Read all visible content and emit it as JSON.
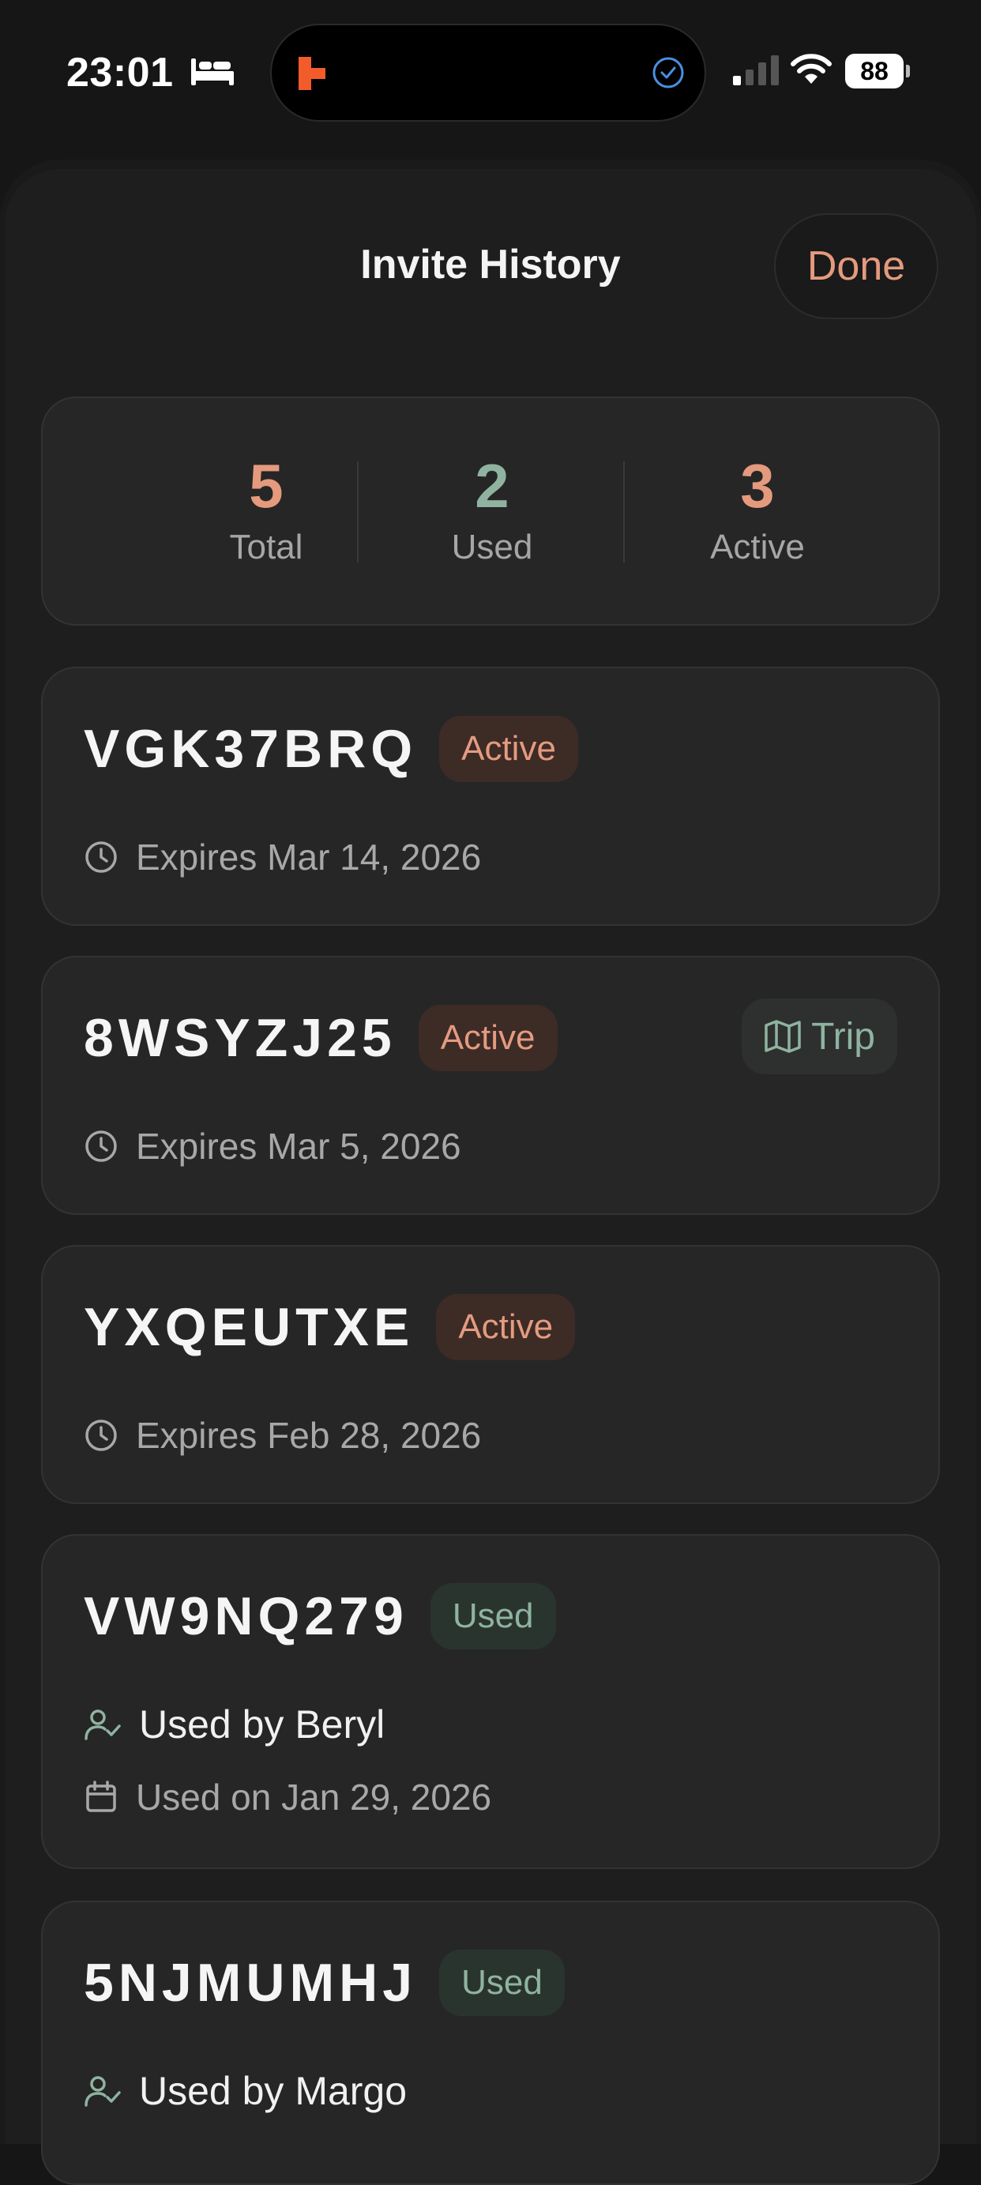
{
  "status_bar": {
    "time": "23:01",
    "battery": "88"
  },
  "header": {
    "title": "Invite History",
    "done_label": "Done"
  },
  "stats": [
    {
      "value": "5",
      "label": "Total",
      "color": "#e59a7e"
    },
    {
      "value": "2",
      "label": "Used",
      "color": "#8fb3a0"
    },
    {
      "value": "3",
      "label": "Active",
      "color": "#e59a7e"
    }
  ],
  "invites": [
    {
      "code": "VGK37BRQ",
      "status": "Active",
      "expires": "Expires Mar 14, 2026"
    },
    {
      "code": "8WSYZJ25",
      "status": "Active",
      "trip_label": "Trip",
      "expires": "Expires Mar 5, 2026"
    },
    {
      "code": "YXQEUTXE",
      "status": "Active",
      "expires": "Expires Feb 28, 2026"
    },
    {
      "code": "VW9NQ279",
      "status": "Used",
      "used_by": "Used by Beryl",
      "used_on": "Used on Jan 29, 2026"
    },
    {
      "code": "5NJMUMHJ",
      "status": "Used",
      "used_by": "Used by Margo"
    }
  ],
  "colors": {
    "accent_active": "#e59a7e",
    "accent_used": "#8fb3a0",
    "background": "#161616"
  },
  "icons": [
    "bed-icon",
    "clock-icon",
    "map-icon",
    "user-check-icon",
    "calendar-icon"
  ]
}
